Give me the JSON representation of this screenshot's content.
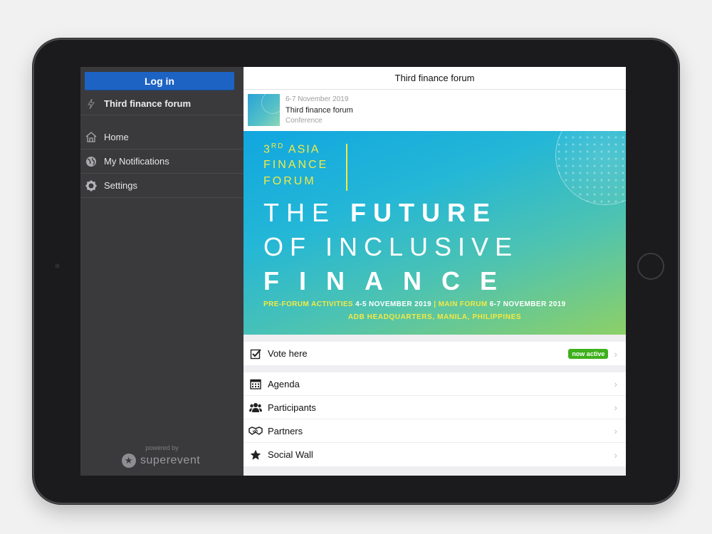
{
  "sidebar": {
    "login_label": "Log in",
    "event_name": "Third finance forum",
    "nav": [
      {
        "label": "Home",
        "icon": "home-icon"
      },
      {
        "label": "My Notifications",
        "icon": "globe-icon"
      },
      {
        "label": "Settings",
        "icon": "gear-icon"
      }
    ],
    "powered_by": "powered by",
    "brand": "superevent"
  },
  "header": {
    "title": "Third finance forum"
  },
  "event_card": {
    "date": "6-7 November 2019",
    "title": "Third finance forum",
    "type": "Conference"
  },
  "banner": {
    "line1_prefix": "3",
    "line1_sup": "RD",
    "line1_rest": " ASIA",
    "line2": "FINANCE",
    "line3": "FORUM",
    "headline1_thin": "THE ",
    "headline1_bold": "FUTURE",
    "headline2_thin": "OF ",
    "headline2_bold": "INCLUSIVE",
    "headline3": "FINANCE",
    "pre_forum_label": "PRE-FORUM ACTIVITIES",
    "pre_forum_dates": "4-5 NOVEMBER 2019",
    "separator": "|",
    "main_forum_label": "MAIN FORUM",
    "main_forum_dates": "6-7 NOVEMBER 2019",
    "venue": "ADB HEADQUARTERS, MANILA, PHILIPPINES",
    "colors": {
      "accent": "#f4ea42"
    }
  },
  "vote": {
    "label": "Vote here",
    "badge": "now active"
  },
  "menu": [
    {
      "label": "Agenda",
      "icon": "calendar-icon"
    },
    {
      "label": "Participants",
      "icon": "people-icon"
    },
    {
      "label": "Partners",
      "icon": "handshake-icon"
    },
    {
      "label": "Social Wall",
      "icon": "star-icon"
    }
  ],
  "colors": {
    "login_button": "#1d63c4",
    "sidebar_bg": "#3a3a3c",
    "badge": "#3db01c"
  }
}
